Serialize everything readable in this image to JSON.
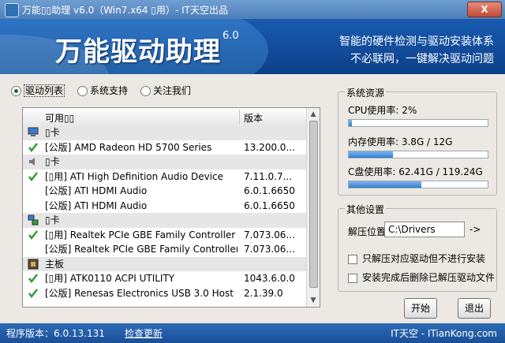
{
  "window": {
    "title": "万能▯▯助理 v6.0（Win7.x64 ▯用）- IT天空出品",
    "close_label": "X"
  },
  "banner": {
    "brand": "万能驱动助理",
    "version": "6.0",
    "slogan_line1": "智能的硬件检测与驱动安装体系",
    "slogan_line2": "不必联网，一键解决驱动问题"
  },
  "tabs": [
    {
      "label": "驱动列表",
      "selected": true
    },
    {
      "label": "系统支持",
      "selected": false
    },
    {
      "label": "关注我们",
      "selected": false
    }
  ],
  "driver_list": {
    "col_name": "可用▯▯",
    "col_version": "版本",
    "rows": [
      {
        "type": "category",
        "icon": "display-icon",
        "name": "▯卡",
        "version": ""
      },
      {
        "type": "item",
        "checked": true,
        "name": "[公版] AMD Radeon HD 5700 Series",
        "version": "13.200.0..."
      },
      {
        "type": "category",
        "icon": "speaker-icon",
        "name": "▯卡",
        "version": ""
      },
      {
        "type": "item",
        "checked": true,
        "name": "[▯用] ATI High Definition Audio Device",
        "version": "7.11.0.7..."
      },
      {
        "type": "item",
        "checked": false,
        "name": "[公版] ATI HDMI Audio",
        "version": "6.0.1.6650"
      },
      {
        "type": "item",
        "checked": false,
        "name": "[公版] ATI HDMI Audio",
        "version": "6.0.1.6650"
      },
      {
        "type": "category",
        "icon": "network-icon",
        "name": "▯卡",
        "version": ""
      },
      {
        "type": "item",
        "checked": true,
        "name": "[▯用] Realtek PCIe GBE Family Controller",
        "version": "7.073.06..."
      },
      {
        "type": "item",
        "checked": false,
        "name": "[公版] Realtek PCIe GBE Family Controller",
        "version": "7.073.06..."
      },
      {
        "type": "category",
        "icon": "motherboard-icon",
        "name": "主板",
        "version": ""
      },
      {
        "type": "item",
        "checked": true,
        "name": "[▯用] ATK0110 ACPI UTILITY",
        "version": "1043.6.0.0"
      },
      {
        "type": "item",
        "checked": true,
        "name": "[公版] Renesas Electronics USB 3.0 Host ...",
        "version": "2.1.39.0"
      }
    ]
  },
  "resources": {
    "title": "系统资源",
    "cpu_label": "CPU使用率: 2%",
    "cpu_percent": 2,
    "mem_label": "内存使用率: 3.8G / 12G",
    "mem_percent": 32,
    "disk_label": "C盘使用率: 62.41G / 119.24G",
    "disk_percent": 52
  },
  "settings": {
    "title": "其他设置",
    "extract_label": "解压位置",
    "extract_value": "C:\\Drivers",
    "arrow_label": "->",
    "opt1": "只解压对应驱动但不进行安装",
    "opt2": "安装完成后删除已解压驱动文件"
  },
  "buttons": {
    "start": "开始",
    "exit": "退出"
  },
  "statusbar": {
    "version": "程序版本：6.0.13.131",
    "update": "检查更新",
    "site": "IT天空 - ITianKong.com"
  },
  "colors": {
    "accent": "#1a5bb0",
    "check": "#2e9b2e",
    "bar_fill": "#2e7fd2"
  }
}
